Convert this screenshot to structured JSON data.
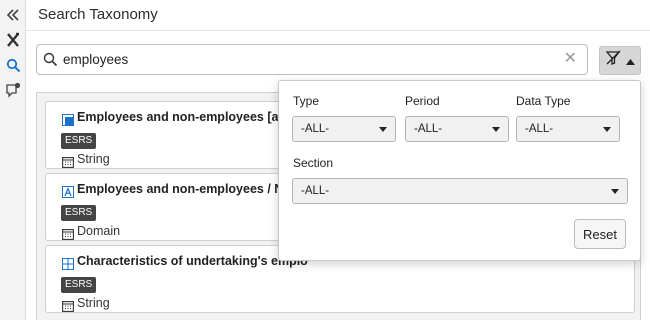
{
  "header": {
    "title": "Search Taxonomy"
  },
  "search": {
    "value": "employees"
  },
  "results": [
    {
      "name": "Employees and non-employees [axis]",
      "badge": "ESRS",
      "datatype": "String",
      "icon": "axis-icon"
    },
    {
      "name": "Employees and non-employees / NA [me",
      "badge": "ESRS",
      "datatype": "Domain",
      "icon": "member-icon"
    },
    {
      "name": "Characteristics of undertaking's emplo",
      "badge": "ESRS",
      "datatype": "String",
      "icon": "table-icon"
    }
  ],
  "filters": {
    "type_label": "Type",
    "period_label": "Period",
    "datatype_label": "Data Type",
    "section_label": "Section",
    "type_value": "-ALL-",
    "period_value": "-ALL-",
    "datatype_value": "-ALL-",
    "section_value": "-ALL-",
    "reset_label": "Reset"
  },
  "colors": {
    "accent": "#1a73c9",
    "badge_bg": "#444444",
    "filter_btn_bg": "#d6d6d6"
  }
}
